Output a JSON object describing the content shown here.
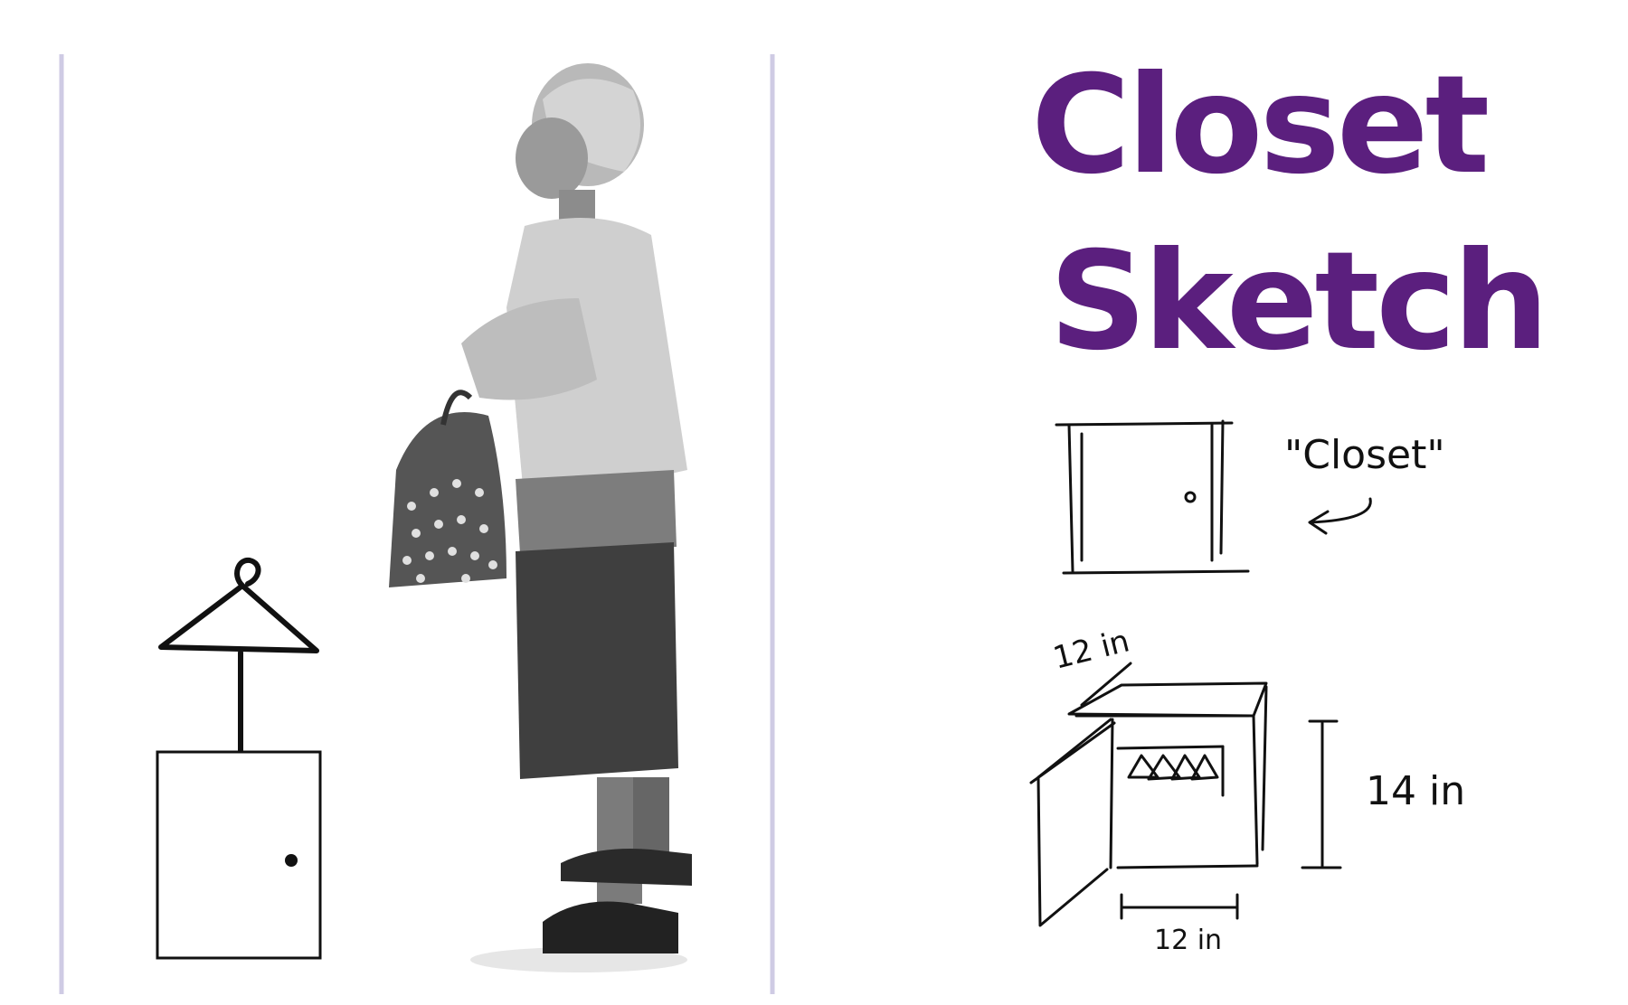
{
  "title": {
    "line1": "Closet",
    "line2": "Sketch",
    "color": "#5b1f7e"
  },
  "sketch": {
    "closet_label": "\"Closet\"",
    "depth_label": "12 in",
    "height_label": "14 in",
    "width_label": "12 in"
  },
  "colors": {
    "divider": "#cfcbe4",
    "ink": "#111111",
    "photo_gray": "#6f6f6f"
  },
  "icons": {
    "hanger": "hanger-icon",
    "door": "door-icon"
  }
}
